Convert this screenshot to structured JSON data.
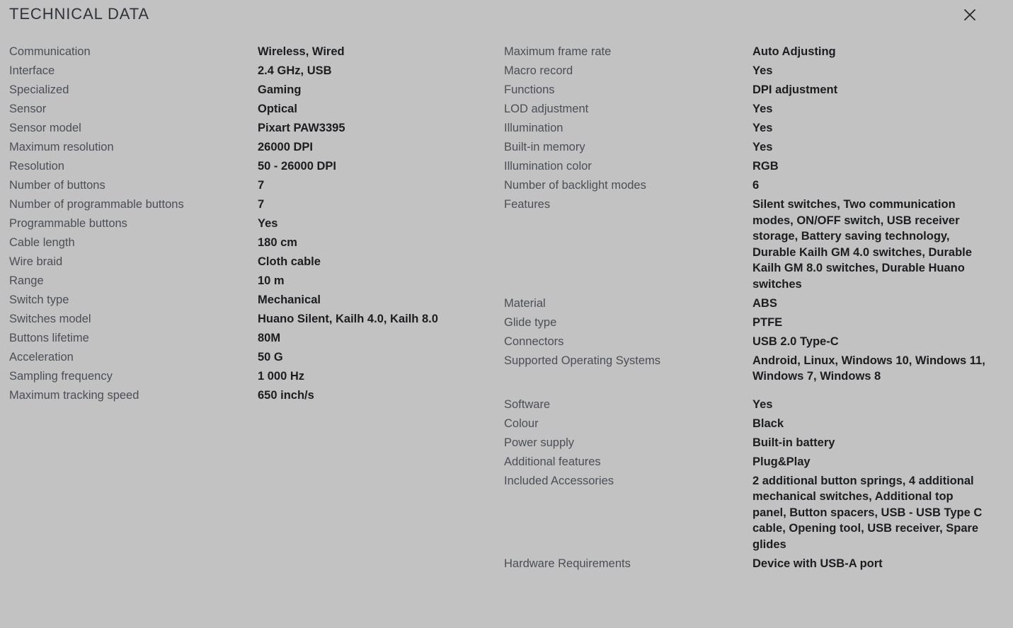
{
  "header": {
    "title": "TECHNICAL DATA",
    "close_icon": "close-icon"
  },
  "columns": {
    "left": [
      {
        "label": "Communication",
        "value": "Wireless, Wired"
      },
      {
        "label": "Interface",
        "value": "2.4 GHz, USB"
      },
      {
        "label": "Specialized",
        "value": "Gaming"
      },
      {
        "label": "Sensor",
        "value": "Optical"
      },
      {
        "label": "Sensor model",
        "value": "Pixart PAW3395"
      },
      {
        "label": "Maximum resolution",
        "value": "26000 DPI"
      },
      {
        "label": "Resolution",
        "value": "50 - 26000 DPI"
      },
      {
        "label": "Number of buttons",
        "value": "7"
      },
      {
        "label": "Number of programmable buttons",
        "value": "7"
      },
      {
        "label": "Programmable buttons",
        "value": "Yes"
      },
      {
        "label": "Cable length",
        "value": "180 cm"
      },
      {
        "label": "Wire braid",
        "value": "Cloth cable"
      },
      {
        "label": "Range",
        "value": "10 m"
      },
      {
        "label": "Switch type",
        "value": "Mechanical"
      },
      {
        "label": "Switches model",
        "value": "Huano Silent, Kailh 4.0, Kailh 8.0"
      },
      {
        "label": "Buttons lifetime",
        "value": "80M"
      },
      {
        "label": "Acceleration",
        "value": "50 G"
      },
      {
        "label": "Sampling frequency",
        "value": "1 000 Hz"
      },
      {
        "label": "Maximum tracking speed",
        "value": "650 inch/s"
      }
    ],
    "right": [
      {
        "label": "Maximum frame rate",
        "value": "Auto Adjusting"
      },
      {
        "label": "Macro record",
        "value": "Yes"
      },
      {
        "label": "Functions",
        "value": "DPI adjustment"
      },
      {
        "label": "LOD adjustment",
        "value": "Yes"
      },
      {
        "label": "Illumination",
        "value": "Yes"
      },
      {
        "label": "Built-in memory",
        "value": "Yes"
      },
      {
        "label": "Illumination color",
        "value": "RGB"
      },
      {
        "label": "Number of backlight modes",
        "value": "6"
      },
      {
        "label": "Features",
        "value": "Silent switches, Two communication modes, ON/OFF switch, USB receiver storage, Battery saving technology, Durable Kailh GM 4.0 switches, Durable Kailh GM 8.0 switches, Durable Huano switches"
      },
      {
        "label": "Material",
        "value": "ABS"
      },
      {
        "label": "Glide type",
        "value": "PTFE"
      },
      {
        "label": "Connectors",
        "value": "USB 2.0 Type-C"
      },
      {
        "label": "Supported Operating Systems",
        "value": "Android, Linux, Windows 10, Windows 11, Windows 7, Windows 8"
      },
      {
        "label": "Software",
        "value": "Yes"
      },
      {
        "label": "Colour",
        "value": "Black"
      },
      {
        "label": "Power supply",
        "value": "Built-in battery"
      },
      {
        "label": "Additional features",
        "value": "Plug&Play"
      },
      {
        "label": "Included Accessories",
        "value": "2 additional button springs, 4 additional mechanical switches, Additional top panel, Button spacers, USB - USB Type C cable, Opening tool, USB receiver, Spare glides"
      },
      {
        "label": "Hardware Requirements",
        "value": "Device with USB-A port"
      }
    ]
  },
  "colors": {
    "background": "#c2c2c2",
    "label_text": "#4a4f57",
    "value_text": "#1b1d21",
    "title_text": "#2f333a"
  }
}
